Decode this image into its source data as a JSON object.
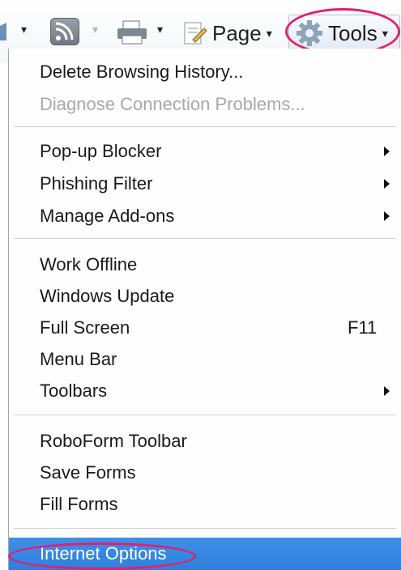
{
  "toolbar": {
    "page_label": "Page",
    "tools_label": "Tools",
    "caret": "▾"
  },
  "menu": {
    "items": [
      {
        "label": "Delete Browsing History..."
      },
      {
        "label": "Diagnose Connection Problems...",
        "disabled": true
      },
      {
        "label": "Pop-up Blocker",
        "submenu": true
      },
      {
        "label": "Phishing Filter",
        "submenu": true
      },
      {
        "label": "Manage Add-ons",
        "submenu": true
      },
      {
        "label": "Work Offline"
      },
      {
        "label": "Windows Update"
      },
      {
        "label": "Full Screen",
        "shortcut": "F11"
      },
      {
        "label": "Menu Bar"
      },
      {
        "label": "Toolbars",
        "submenu": true
      },
      {
        "label": "RoboForm Toolbar"
      },
      {
        "label": "Save Forms"
      },
      {
        "label": "Fill Forms"
      },
      {
        "label": "Internet Options",
        "highlighted": true
      }
    ]
  },
  "colors": {
    "highlight": "#2f7fdc",
    "annotation_ring": "#e2206b"
  },
  "icons": [
    "home-icon",
    "feeds-icon",
    "print-icon",
    "page-icon",
    "gear-icon"
  ]
}
